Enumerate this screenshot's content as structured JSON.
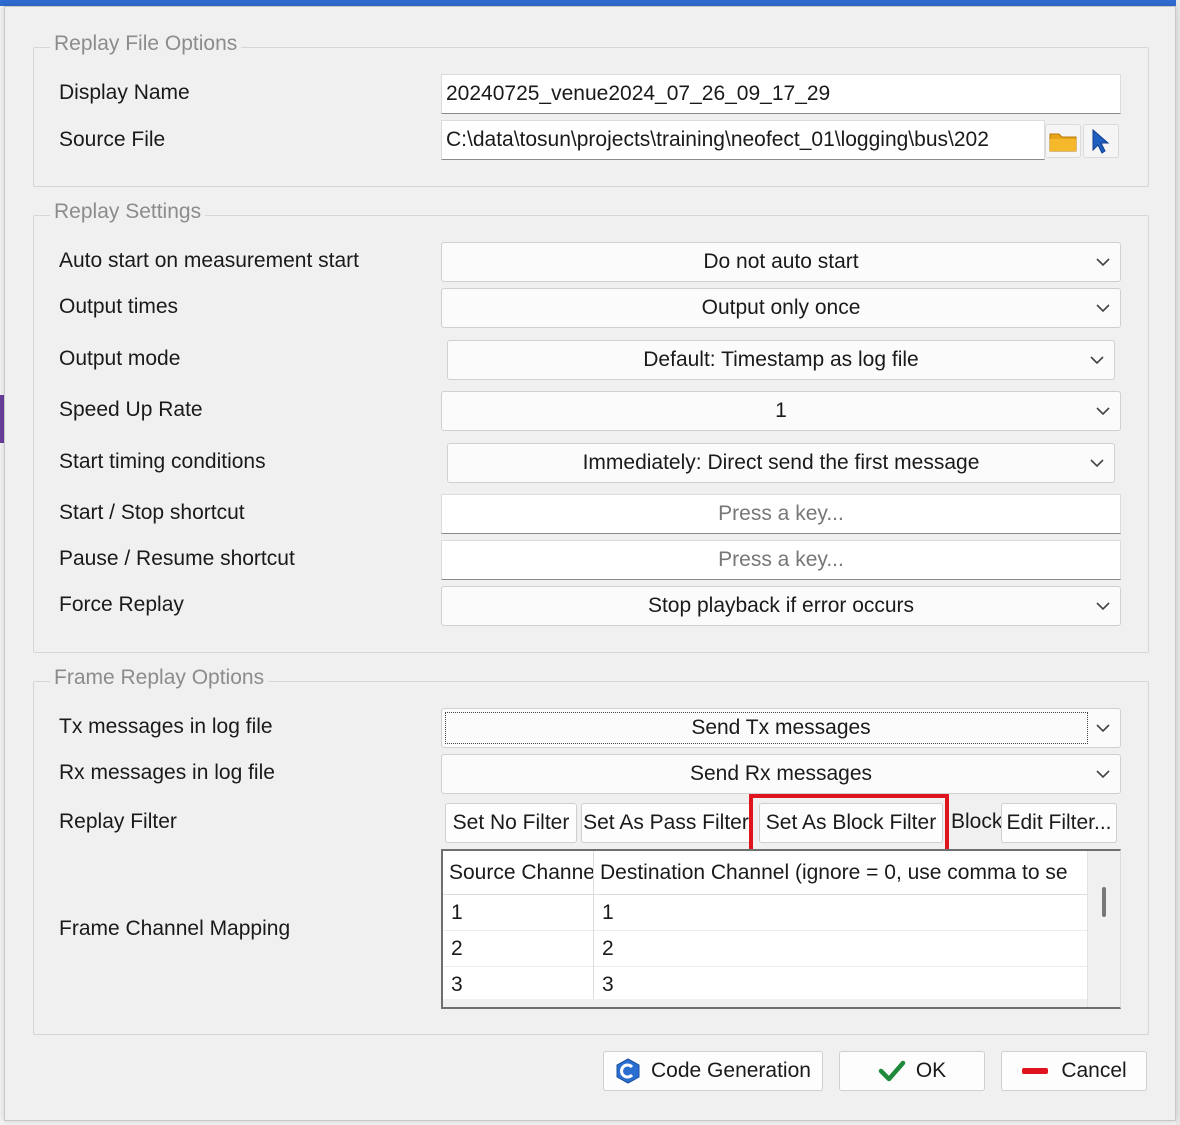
{
  "replay_file_options": {
    "title": "Replay File Options",
    "display_name_label": "Display Name",
    "display_name_value": "20240725_venue2024_07_26_09_17_29",
    "source_file_label": "Source File",
    "source_file_value": "C:\\data\\tosun\\projects\\training\\neofect_01\\logging\\bus\\202"
  },
  "replay_settings": {
    "title": "Replay Settings",
    "auto_start_label": "Auto start on measurement start",
    "auto_start_value": "Do not auto start",
    "output_times_label": "Output times",
    "output_times_value": "Output only once",
    "output_mode_label": "Output mode",
    "output_mode_value": "Default: Timestamp as log file",
    "speed_up_label": "Speed Up Rate",
    "speed_up_value": "1",
    "start_timing_label": "Start timing conditions",
    "start_timing_value": "Immediately: Direct send the first message",
    "start_stop_label": "Start / Stop shortcut",
    "start_stop_placeholder": "Press a key...",
    "pause_resume_label": "Pause / Resume shortcut",
    "pause_resume_placeholder": "Press a key...",
    "force_replay_label": "Force Replay",
    "force_replay_value": "Stop playback if error occurs"
  },
  "frame_replay_options": {
    "title": "Frame Replay Options",
    "tx_label": "Tx messages in log file",
    "tx_value": "Send Tx messages",
    "rx_label": "Rx messages in log file",
    "rx_value": "Send Rx messages",
    "filter_label": "Replay Filter",
    "filter_buttons": {
      "no_filter": "Set No Filter",
      "pass_filter": "Set As Pass Filter",
      "block_filter": "Set As Block Filter",
      "block_truncated": "Block",
      "edit_filter": "Edit Filter..."
    },
    "mapping_label": "Frame Channel Mapping",
    "mapping_table": {
      "columns": [
        "Source Channel",
        "Destination Channel (ignore = 0, use comma to se"
      ],
      "rows": [
        [
          "1",
          "1"
        ],
        [
          "2",
          "2"
        ],
        [
          "3",
          "3"
        ]
      ]
    }
  },
  "footer": {
    "code_generation": "Code Generation",
    "ok": "OK",
    "cancel": "Cancel"
  },
  "colors": {
    "highlight": "#e0141e",
    "ok_check": "#1f8a3b",
    "cancel_bar": "#e0141e",
    "cursor_icon": "#1f5fbf",
    "folder_icon": "#e8a317"
  }
}
